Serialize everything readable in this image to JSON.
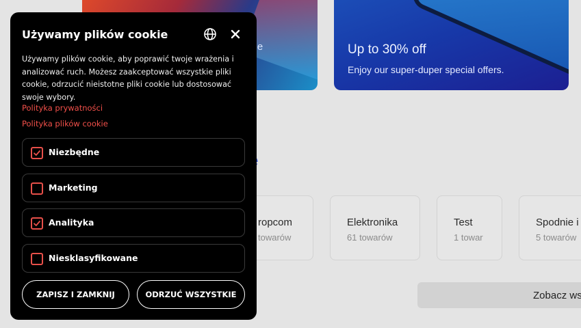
{
  "background": {
    "banner_left": {
      "subtitle": "mobile"
    },
    "banner_right": {
      "title": "Up to 30% off",
      "subtitle": "Enjoy our super-duper special offers."
    },
    "section_heading_fragment": "e",
    "categories": [
      {
        "name": "ropcom",
        "count": "towarów"
      },
      {
        "name": "Elektronika",
        "count": "61 towarów"
      },
      {
        "name": "Test",
        "count": "1 towar"
      },
      {
        "name": "Spodnie i",
        "count": "5 towarów"
      }
    ],
    "see_all_label": "Zobacz wsz"
  },
  "cookie": {
    "title": "Używamy plików cookie",
    "description": "Używamy plików cookie, aby poprawić twoje wrażenia i analizować ruch. Możesz zaakceptować wszystkie pliki cookie, odrzucić nieistotne pliki cookie lub dostosować swoje wybory.",
    "privacy_link": "Polityka prywatności",
    "cookie_policy_link": "Polityka plików cookie",
    "options": [
      {
        "label": "Niezbędne",
        "checked": true
      },
      {
        "label": "Marketing",
        "checked": false
      },
      {
        "label": "Analityka",
        "checked": true
      },
      {
        "label": "Niesklasyfikowane",
        "checked": false
      }
    ],
    "save_button": "ZAPISZ I ZAMKNIJ",
    "reject_button": "ODRZUĆ WSZYSTKIE",
    "accent_color": "#e8504a",
    "globe_icon": "globe-icon",
    "close_icon": "close-icon"
  }
}
